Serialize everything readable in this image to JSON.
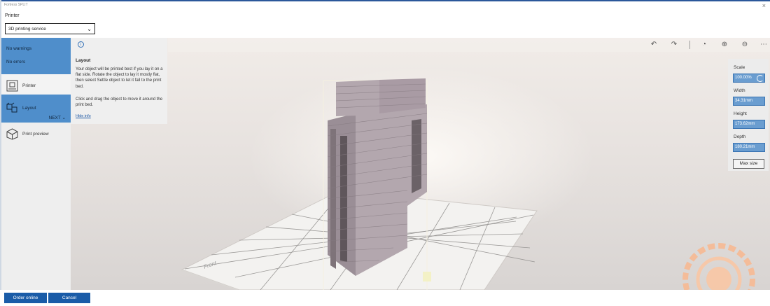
{
  "window": {
    "title": "Fortress SPLIT"
  },
  "printer": {
    "label": "Printer",
    "selected": "3D printing service"
  },
  "sidebar": {
    "warnings": "No warnings",
    "errors": "No errors",
    "items": [
      {
        "label": "Printer"
      },
      {
        "label": "Layout",
        "next": "NEXT"
      },
      {
        "label": "Print preview"
      }
    ]
  },
  "info": {
    "title": "Layout",
    "paragraph1": "Your object will be printed best if you lay it on a flat side. Rotate the object to lay it mostly flat, then select Settle object to let it fall to the print bed.",
    "paragraph2": "Click and drag the object to move it around the print bed.",
    "hide": "Hide info"
  },
  "properties": {
    "scale_label": "Scale",
    "scale_value": "100.00%",
    "width_label": "Width",
    "width_value": "34.31mm",
    "height_label": "Height",
    "height_value": "173.62mm",
    "depth_label": "Depth",
    "depth_value": "180.21mm",
    "max_size": "Max size"
  },
  "scene": {
    "bed_label": "Front"
  },
  "buttons": {
    "order": "Order online",
    "cancel": "Cancel"
  },
  "watermark": {
    "text": "SNAPIT 3D FASTONS",
    "center": "3D"
  },
  "colors": {
    "accent": "#1a5ca8",
    "sidebar_active": "#4f8ecb",
    "brick": "#a99ba4",
    "bed": "#f2f2f0",
    "watermark": "#f6b992"
  }
}
